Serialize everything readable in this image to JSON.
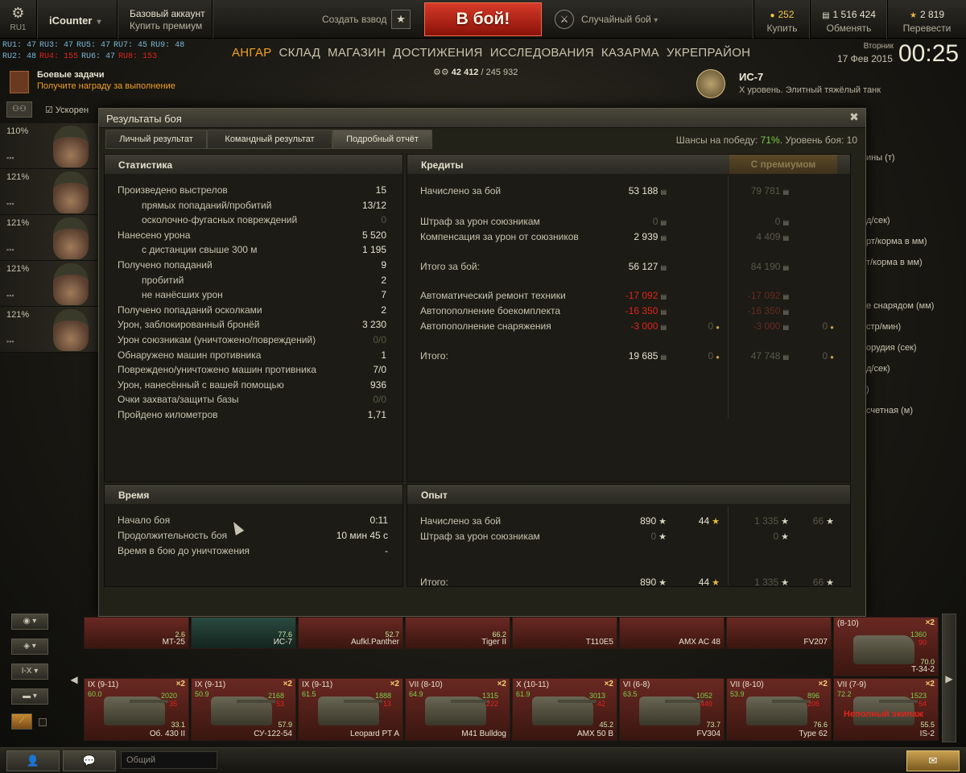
{
  "topbar": {
    "server": "RU1",
    "account_name": "iCounter",
    "premium_title": "Базовый аккаунт",
    "premium_buy": "Купить премиум",
    "platoon": "Создать взвод",
    "battle_button": "В бой!",
    "battle_mode": "Случайный бой",
    "gold_value": "252",
    "gold_label": "Купить",
    "credits_value": "1 516 424",
    "credits_label": "Обменять",
    "free_exp_value": "2 819",
    "free_exp_label": "Перевести"
  },
  "servers": [
    {
      "name": "RU1:",
      "count": "47",
      "color": "#7ab8d8"
    },
    {
      "name": "RU3:",
      "count": "47",
      "color": "#7ab8d8"
    },
    {
      "name": "RU5:",
      "count": "47",
      "color": "#7ab8d8"
    },
    {
      "name": "RU7:",
      "count": "45",
      "color": "#7ab8d8"
    },
    {
      "name": "RU9:",
      "count": "48",
      "color": "#7ab8d8"
    },
    {
      "name": "RU2:",
      "count": "48",
      "color": "#7ab8d8"
    },
    {
      "name": "RU4:",
      "count": "155",
      "color": "#e0241c"
    },
    {
      "name": "RU6:",
      "count": "47",
      "color": "#7ab8d8"
    },
    {
      "name": "RU8:",
      "count": "153",
      "color": "#e0241c"
    }
  ],
  "nav": [
    "АНГАР",
    "СКЛАД",
    "МАГАЗИН",
    "ДОСТИЖЕНИЯ",
    "ИССЛЕДОВАНИЯ",
    "КАЗАРМА",
    "УКРЕПРАЙОН"
  ],
  "clock": {
    "day": "Вторник",
    "date": "17 Фев 2015",
    "time": "00:25"
  },
  "hangar_exp": {
    "value": "42 412",
    "total": "245 932"
  },
  "missions": {
    "title": "Боевые задачи",
    "subtitle": "Получите награду за выполнение"
  },
  "accel": "Ускорен",
  "tank": {
    "name": "ИС-7",
    "desc": "X уровень. Элитный тяжёлый танк"
  },
  "crew": [
    {
      "pct": "110%"
    },
    {
      "pct": "121%"
    },
    {
      "pct": "121%"
    },
    {
      "pct": "121%"
    },
    {
      "pct": "121%"
    }
  ],
  "right_stats": [
    "ины (т)",
    "д/сек)",
    "рт/корма в мм)",
    "т/корма в мм)",
    "е снарядом (мм)",
    "стр/мин)",
    "орудия (сек)",
    "д/сек)",
    ")",
    "счетная (м)"
  ],
  "dialog": {
    "title": "Результаты боя",
    "tabs": [
      "Личный результат",
      "Командный результат",
      "Подробный отчёт"
    ],
    "chances_label": "Шансы на победу:",
    "chances_value": "71%",
    "battle_level": ". Уровень боя: 10",
    "stats_title": "Статистика",
    "credits_title": "Кредиты",
    "premium_title": "С премиумом",
    "time_title": "Время",
    "exp_title": "Опыт"
  },
  "statistics": [
    {
      "label": "Произведено выстрелов",
      "value": "15",
      "indent": false,
      "dim": false
    },
    {
      "label": "прямых попаданий/пробитий",
      "value": "13/12",
      "indent": true,
      "dim": false
    },
    {
      "label": "осколочно-фугасных повреждений",
      "value": "0",
      "indent": true,
      "dim": true
    },
    {
      "label": "Нанесено урона",
      "value": "5 520",
      "indent": false,
      "dim": false
    },
    {
      "label": "с дистанции свыше 300 м",
      "value": "1 195",
      "indent": true,
      "dim": false
    },
    {
      "label": "Получено попаданий",
      "value": "9",
      "indent": false,
      "dim": false
    },
    {
      "label": "пробитий",
      "value": "2",
      "indent": true,
      "dim": false
    },
    {
      "label": "не нанёсших урон",
      "value": "7",
      "indent": true,
      "dim": false
    },
    {
      "label": "Получено попаданий осколками",
      "value": "2",
      "indent": false,
      "dim": false
    },
    {
      "label": "Урон, заблокированный бронёй",
      "value": "3 230",
      "indent": false,
      "dim": false
    },
    {
      "label": "Урон союзникам (уничтожено/повреждений)",
      "value": "0/0",
      "indent": false,
      "dim": true
    },
    {
      "label": "Обнаружено машин противника",
      "value": "1",
      "indent": false,
      "dim": false
    },
    {
      "label": "Повреждено/уничтожено машин противника",
      "value": "7/0",
      "indent": false,
      "dim": false
    },
    {
      "label": "Урон, нанесённый с вашей помощью",
      "value": "936",
      "indent": false,
      "dim": false
    },
    {
      "label": "Очки захвата/защиты базы",
      "value": "0/0",
      "indent": false,
      "dim": true
    },
    {
      "label": "Пройдено километров",
      "value": "1,71",
      "indent": false,
      "dim": false
    }
  ],
  "credits": [
    {
      "label": "Начислено за бой",
      "value": "53 188",
      "vstyle": "",
      "gold": "",
      "prem": "79 781",
      "pstyle": "dim",
      "pgold": ""
    },
    {
      "label": "Штраф за урон союзникам",
      "value": "0",
      "vstyle": "dim",
      "gold": "",
      "prem": "0",
      "pstyle": "dim",
      "pgold": ""
    },
    {
      "label": "Компенсация за урон от союзников",
      "value": "2 939",
      "vstyle": "",
      "gold": "",
      "prem": "4 409",
      "pstyle": "dim",
      "pgold": ""
    },
    {
      "label": "Итого за бой:",
      "value": "56 127",
      "vstyle": "",
      "gold": "",
      "prem": "84 190",
      "pstyle": "dim",
      "pgold": ""
    },
    {
      "label": "Автоматический ремонт техники",
      "value": "-17 092",
      "vstyle": "red",
      "gold": "",
      "prem": "-17 092",
      "pstyle": "redd",
      "pgold": ""
    },
    {
      "label": "Автопополнение боекомплекта",
      "value": "-16 350",
      "vstyle": "red",
      "gold": "",
      "prem": "-16 350",
      "pstyle": "redd",
      "pgold": ""
    },
    {
      "label": "Автопополнение снаряжения",
      "value": "-3 000",
      "vstyle": "red",
      "gold": "0",
      "prem": "-3 000",
      "pstyle": "redd",
      "pgold": "0"
    },
    {
      "label": "Итого:",
      "value": "19 685",
      "vstyle": "",
      "gold": "0",
      "prem": "47 748",
      "pstyle": "dim",
      "pgold": "0"
    }
  ],
  "time": [
    {
      "label": "Начало боя",
      "value": "0:11"
    },
    {
      "label": "Продолжительность боя",
      "value": "10 мин 45 с"
    },
    {
      "label": "Время в бою до уничтожения",
      "value": "-"
    }
  ],
  "experience": [
    {
      "label": "Начислено за бой",
      "value": "890",
      "vstyle": "",
      "free": "44",
      "prem": "1 335",
      "pfree": "66"
    },
    {
      "label": "Штраф за урон союзникам",
      "value": "0",
      "vstyle": "dim",
      "free": "",
      "prem": "0",
      "pfree": ""
    },
    {
      "label": "Итого:",
      "value": "890",
      "vstyle": "",
      "free": "44",
      "prem": "1 335",
      "pfree": "66"
    }
  ],
  "carousel_top": [
    {
      "name": "MT-25",
      "pct": "2.6",
      "sel": false
    },
    {
      "name": "ИС-7",
      "pct": "77.6",
      "sel": true
    },
    {
      "name": "Aufkl.Panther",
      "pct": "52.7",
      "sel": false
    },
    {
      "name": "Tiger II",
      "pct": "66.2",
      "sel": false
    },
    {
      "name": "T110E5",
      "pct": "",
      "sel": false
    },
    {
      "name": "AMX AC 48",
      "pct": "",
      "sel": false
    },
    {
      "name": "FV207",
      "pct": "",
      "sel": false
    },
    {
      "name": "T-34-2",
      "pct": "70.0",
      "sel": false,
      "head": "(8-10)",
      "x2": "×2",
      "r1": "1360",
      "r2": "90"
    }
  ],
  "carousel_bottom": [
    {
      "tier": "IX (9-11)",
      "x2": "×2",
      "blip": "60.0",
      "r1": "2020",
      "r2": "35",
      "pct": "33.1",
      "name": "Об. 430 II",
      "warn": ""
    },
    {
      "tier": "IX (9-11)",
      "x2": "×2",
      "blip": "50.9",
      "r1": "2168",
      "r2": "53",
      "pct": "57.9",
      "name": "СУ-122-54",
      "warn": ""
    },
    {
      "tier": "IX (9-11)",
      "x2": "×2",
      "blip": "61.5",
      "r1": "1888",
      "r2": "13",
      "pct": "",
      "name": "Leopard PT A",
      "warn": ""
    },
    {
      "tier": "VII (8-10)",
      "x2": "×2",
      "blip": "64.9",
      "r1": "1315",
      "r2": "222",
      "pct": "",
      "name": "M41 Bulldog",
      "warn": ""
    },
    {
      "tier": "X (10-11)",
      "x2": "×2",
      "blip": "61.9",
      "r1": "3013",
      "r2": "42",
      "pct": "45.2",
      "name": "AMX 50 B",
      "warn": ""
    },
    {
      "tier": "VI (6-8)",
      "x2": "",
      "blip": "63.5",
      "r1": "1052",
      "r2": "449",
      "pct": "73.7",
      "name": "FV304",
      "warn": ""
    },
    {
      "tier": "VII (8-10)",
      "x2": "×2",
      "blip": "53.9",
      "r1": "896",
      "r2": "206",
      "pct": "76.6",
      "name": "Type 62",
      "warn": ""
    },
    {
      "tier": "VII (7-9)",
      "x2": "×2",
      "blip": "72.2",
      "r1": "1523",
      "r2": "54",
      "pct": "55.5",
      "name": "IS-2",
      "warn": "Неполный экипаж"
    }
  ],
  "filters": [
    "◉ ▾",
    "◈ ▾",
    "I-X ▾",
    "▬ ▾",
    "⟋"
  ],
  "bottombar": {
    "chat_placeholder": "Общий"
  },
  "colors": {
    "accent": "#f2a020",
    "battle": "#c82a1a",
    "positive": "#7ad04a",
    "negative": "#e0241c"
  },
  "icons": [
    "gear-icon",
    "star-icon",
    "mode-icon",
    "gold-icon",
    "credits-icon",
    "free-exp-icon",
    "close-icon",
    "star-exp-icon",
    "coin-icon",
    "contacts-icon",
    "chat-icon",
    "message-icon"
  ]
}
